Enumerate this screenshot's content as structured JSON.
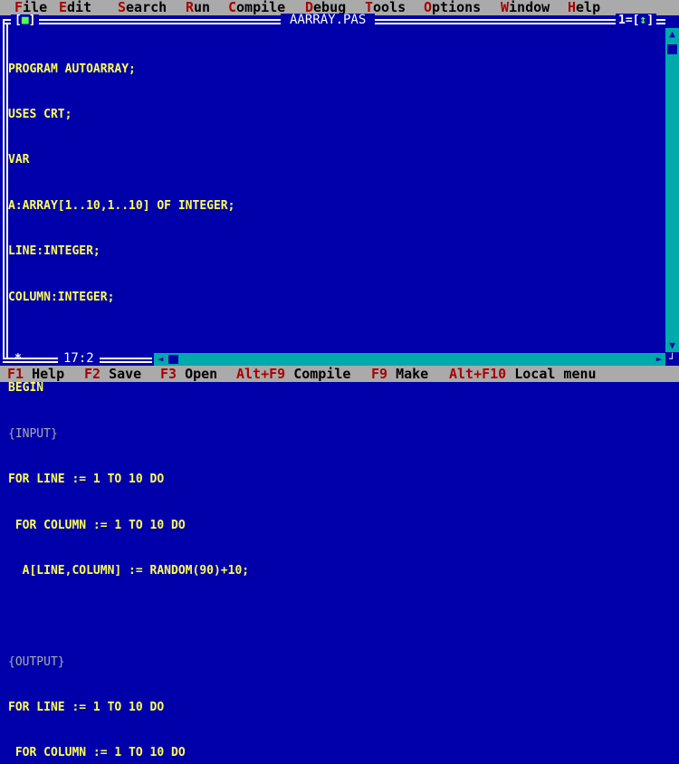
{
  "menu": {
    "items": [
      {
        "hot": "F",
        "rest": "ile"
      },
      {
        "hot": "E",
        "rest": "dit"
      },
      {
        "hot": "S",
        "rest": "earch"
      },
      {
        "hot": "R",
        "rest": "un"
      },
      {
        "hot": "C",
        "rest": "ompile"
      },
      {
        "hot": "D",
        "rest": "ebug"
      },
      {
        "hot": "T",
        "rest": "ools"
      },
      {
        "hot": "O",
        "rest": "ptions"
      },
      {
        "hot": "W",
        "rest": "indow"
      },
      {
        "hot": "H",
        "rest": "elp"
      }
    ]
  },
  "window": {
    "close_box_left": "[",
    "close_box_mark": "■",
    "close_box_right": "]",
    "title": "AARRAY.PAS",
    "number": "1",
    "zoom_left": "[",
    "zoom_mark": "↕",
    "zoom_right": "]",
    "modified_marker": "*",
    "cursor_position": "17:2"
  },
  "code": {
    "lines": [
      "PROGRAM AUTOARRAY;",
      "USES CRT;",
      "VAR",
      "A:ARRAY[1..10,1..10] OF INTEGER;",
      "LINE:INTEGER;",
      "COLUMN:INTEGER;",
      "",
      "BEGIN",
      "{INPUT}",
      "FOR LINE := 1 TO 10 DO",
      " FOR COLUMN := 1 TO 10 DO",
      "  A[LINE,COLUMN] := RANDOM(90)+10;",
      "",
      "{OUTPUT}",
      "FOR LINE := 1 TO 10 DO",
      " FOR COLUMN := 1 TO 10 DO"
    ]
  },
  "statusbar": {
    "items": [
      {
        "key": "F1",
        "label": "Help"
      },
      {
        "key": "F2",
        "label": "Save"
      },
      {
        "key": "F3",
        "label": "Open"
      },
      {
        "key": "Alt+F9",
        "label": "Compile"
      },
      {
        "key": "F9",
        "label": "Make"
      },
      {
        "key": "Alt+F10",
        "label": "Local menu"
      }
    ]
  },
  "colors": {
    "background": "#0000aa",
    "menu_bg": "#aaaaaa",
    "hotkey": "#aa0000",
    "code_text": "#ffff55",
    "comment_text": "#aaaaaa",
    "scrollbar": "#00aaaa",
    "frame": "#ffffff"
  }
}
